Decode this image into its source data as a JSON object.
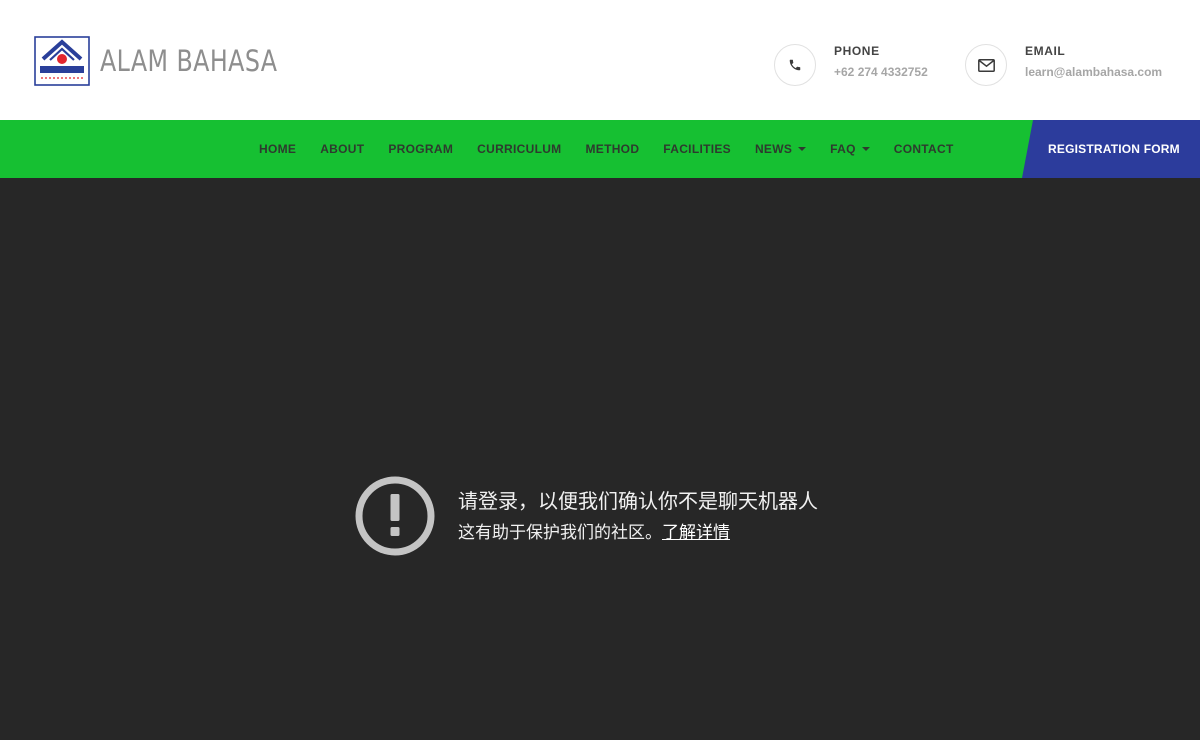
{
  "header": {
    "brand": "ALAM BAHASA",
    "logo_icon": "alam-bahasa-logo",
    "phone": {
      "icon": "phone-icon",
      "label": "PHONE",
      "value": "+62 274 4332752"
    },
    "email": {
      "icon": "envelope-icon",
      "label": "EMAIL",
      "value": "learn@alambahasa.com"
    }
  },
  "nav": {
    "items": [
      {
        "label": "HOME",
        "dropdown": false
      },
      {
        "label": "ABOUT",
        "dropdown": false
      },
      {
        "label": "PROGRAM",
        "dropdown": false
      },
      {
        "label": "CURRICULUM",
        "dropdown": false
      },
      {
        "label": "METHOD",
        "dropdown": false
      },
      {
        "label": "FACILITIES",
        "dropdown": false
      },
      {
        "label": "NEWS",
        "dropdown": true
      },
      {
        "label": "FAQ",
        "dropdown": true
      },
      {
        "label": "CONTACT",
        "dropdown": false
      }
    ],
    "registration_label": "REGISTRATION FORM",
    "bar_color": "#16c032",
    "registration_color": "#2c3c9c"
  },
  "notice": {
    "icon": "exclamation-circle-icon",
    "title": "请登录，以便我们确认你不是聊天机器人",
    "subtitle": "这有助于保护我们的社区。",
    "link_label": "了解详情",
    "background_color": "#272727"
  }
}
